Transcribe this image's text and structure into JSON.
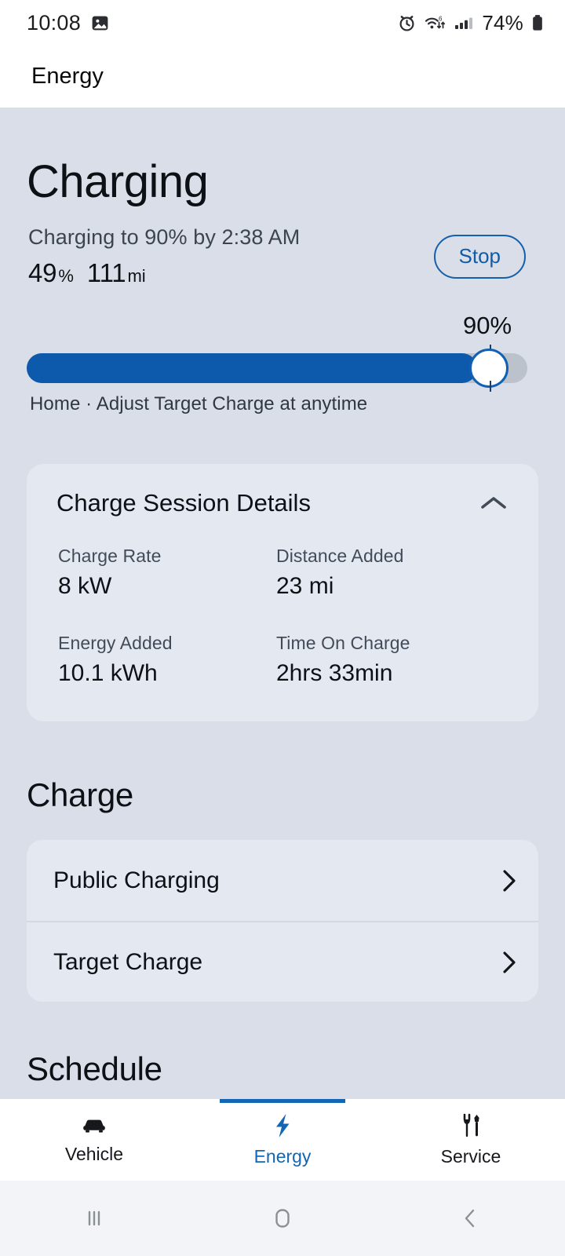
{
  "status_bar": {
    "time": "10:08",
    "battery_percent": "74%",
    "icons": [
      "image-icon",
      "alarm-icon",
      "wifi-icon",
      "cellular-signal-icon",
      "battery-icon"
    ],
    "wifi_generation": "6"
  },
  "app_bar": {
    "title": "Energy"
  },
  "charging": {
    "heading": "Charging",
    "status_line": "Charging to 90% by 2:38 AM",
    "battery_level": "49",
    "battery_unit": "%",
    "range_value": "111",
    "range_unit": "mi",
    "stop_label": "Stop"
  },
  "target_slider": {
    "value_label": "90%",
    "value_percent": 90,
    "caption": "Home · Adjust Target Charge at anytime",
    "fill_color": "#0d59ab",
    "track_color": "#bcc2cb"
  },
  "session_card": {
    "title": "Charge Session Details",
    "collapse_icon": "chevron-up-icon",
    "stats": [
      {
        "label": "Charge Rate",
        "value": "8 kW"
      },
      {
        "label": "Distance Added",
        "value": "23 mi"
      },
      {
        "label": "Energy Added",
        "value": "10.1 kWh"
      },
      {
        "label": "Time On Charge",
        "value": "2hrs 33min"
      }
    ]
  },
  "charge_section": {
    "title": "Charge",
    "rows": [
      {
        "label": "Public Charging",
        "chevron": "chevron-right-icon"
      },
      {
        "label": "Target Charge",
        "chevron": "chevron-right-icon"
      }
    ]
  },
  "schedule_section": {
    "title": "Schedule"
  },
  "bottom_nav": {
    "active": "Energy",
    "accent_color": "#1266b3",
    "tabs": [
      {
        "label": "Vehicle",
        "icon": "car-icon"
      },
      {
        "label": "Energy",
        "icon": "bolt-icon"
      },
      {
        "label": "Service",
        "icon": "wrench-screwdriver-icon"
      }
    ]
  },
  "system_nav": {
    "buttons": [
      {
        "name": "recents",
        "icon": "recents-icon"
      },
      {
        "name": "home",
        "icon": "home-icon"
      },
      {
        "name": "back",
        "icon": "back-icon"
      }
    ]
  }
}
